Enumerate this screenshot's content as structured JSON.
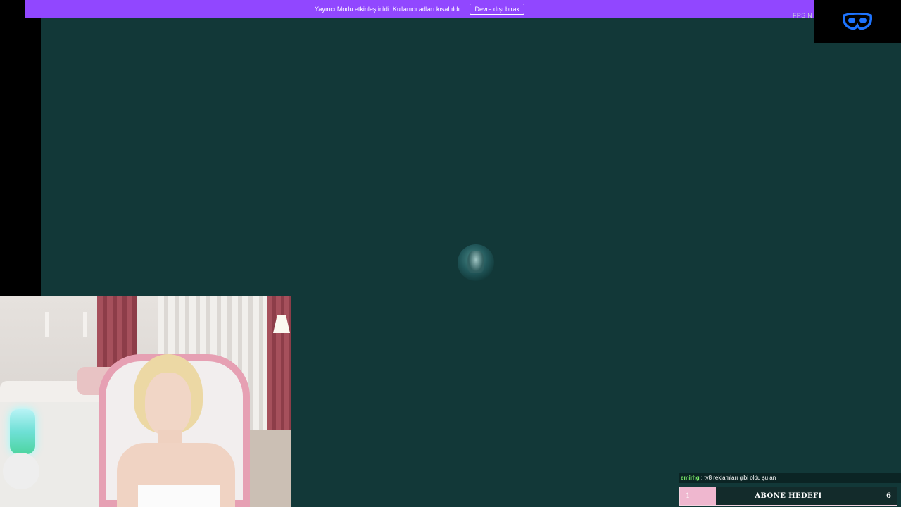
{
  "banner": {
    "message": "Yayıncı Modu etkinleştirildi. Kullanıcı adları kısaltıldı.",
    "disable_button": "Devre dışı bırak",
    "color": "#9147ff"
  },
  "overlay": {
    "fps_label": "FPS N"
  },
  "chat": {
    "username": "emirhg",
    "separator": " : ",
    "message": "tv8 reklamları gibi oldu şu an"
  },
  "sub_goal": {
    "label": "ABONE HEDEFI",
    "current": "1",
    "target": "6",
    "progress_fraction": 0.1667,
    "fill_color": "#efb7cf"
  },
  "icons": {
    "logo": "mask-logo-icon",
    "loading": "loading-spinner-icon"
  }
}
